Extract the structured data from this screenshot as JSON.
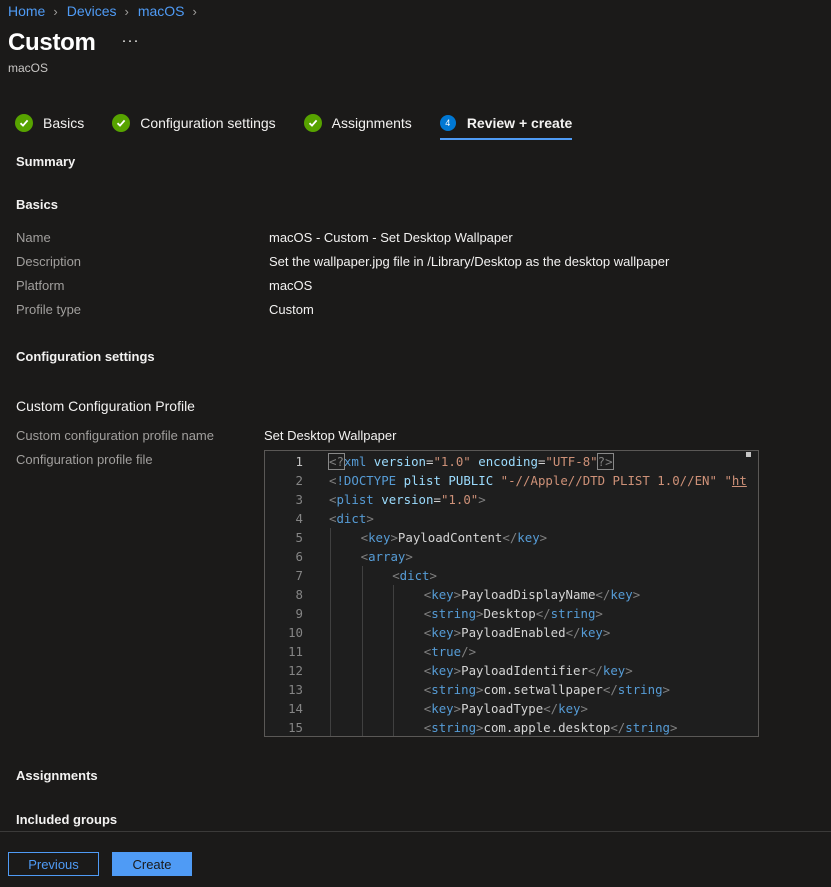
{
  "breadcrumb": [
    "Home",
    "Devices",
    "macOS"
  ],
  "page": {
    "title": "Custom",
    "subtitle": "macOS",
    "more": "···"
  },
  "steps": [
    {
      "label": "Basics",
      "state": "done"
    },
    {
      "label": "Configuration settings",
      "state": "done"
    },
    {
      "label": "Assignments",
      "state": "done"
    },
    {
      "label": "Review + create",
      "state": "active",
      "number": "4"
    }
  ],
  "summary": {
    "heading": "Summary"
  },
  "basics": {
    "heading": "Basics",
    "rows": [
      {
        "label": "Name",
        "value": "macOS - Custom - Set Desktop Wallpaper"
      },
      {
        "label": "Description",
        "value": "Set the wallpaper.jpg file in /Library/Desktop as the desktop wallpaper"
      },
      {
        "label": "Platform",
        "value": "macOS"
      },
      {
        "label": "Profile type",
        "value": "Custom"
      }
    ]
  },
  "config": {
    "heading": "Configuration settings",
    "subheading": "Custom Configuration Profile",
    "name_label": "Custom configuration profile name",
    "name_value": "Set Desktop Wallpaper",
    "file_label": "Configuration profile file"
  },
  "editor": {
    "line_numbers": [
      "1",
      "2",
      "3",
      "4",
      "5",
      "6",
      "7",
      "8",
      "9",
      "10",
      "11",
      "12",
      "13",
      "14",
      "15"
    ],
    "lines": [
      "<?xml version=\"1.0\" encoding=\"UTF-8\"?>",
      "<!DOCTYPE plist PUBLIC \"-//Apple//DTD PLIST 1.0//EN\" \"ht",
      "<plist version=\"1.0\">",
      "<dict>",
      "<key>PayloadContent</key>",
      "<array>",
      "<dict>",
      "<key>PayloadDisplayName</key>",
      "<string>Desktop</string>",
      "<key>PayloadEnabled</key>",
      "<true/>",
      "<key>PayloadIdentifier</key>",
      "<string>com.setwallpaper</string>",
      "<key>PayloadType</key>",
      "<string>com.apple.desktop</string>"
    ]
  },
  "assignments": {
    "heading": "Assignments",
    "included": "Included groups"
  },
  "footer": {
    "previous": "Previous",
    "create": "Create"
  },
  "colors": {
    "accent": "#4f9bf5",
    "success": "#57a300",
    "background": "#1b1a19"
  }
}
